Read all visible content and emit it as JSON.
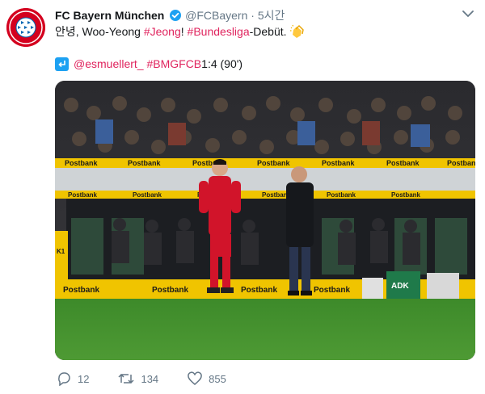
{
  "tweet": {
    "author_name": "FC Bayern München",
    "handle": "@FCBayern",
    "separator": "·",
    "time": "5시간",
    "text": {
      "greeting": "안녕, Woo-Yeong ",
      "hashtag_jeong": "#Jeong",
      "exclaim": "! ",
      "hashtag_bundesliga": "#Bundesliga",
      "debut": "-Debüt. "
    },
    "quote": {
      "mention": "@esmuellert_",
      "hashtag": "#BMGFCB",
      "score": " 1:4 (90')"
    },
    "image": {
      "ad_board_brand": "Postbank",
      "ad_board_2": "ADK",
      "board_number": "K1"
    },
    "actions": {
      "replies": "12",
      "retweets": "134",
      "likes": "855"
    }
  },
  "colors": {
    "link": "#e0245e",
    "verified": "#1da1f2",
    "brand_red": "#d4001f",
    "ad_yellow": "#f0c400",
    "pitch_green": "#3f8a2c"
  },
  "icons": {
    "avatar": "fc-bayern-logo",
    "verified": "verified-badge-icon",
    "caret": "chevron-down-icon",
    "quote_marker": "reply-arrow-icon",
    "emoji": "clapping-hands-icon",
    "reply": "reply-icon",
    "retweet": "retweet-icon",
    "like": "heart-icon"
  }
}
